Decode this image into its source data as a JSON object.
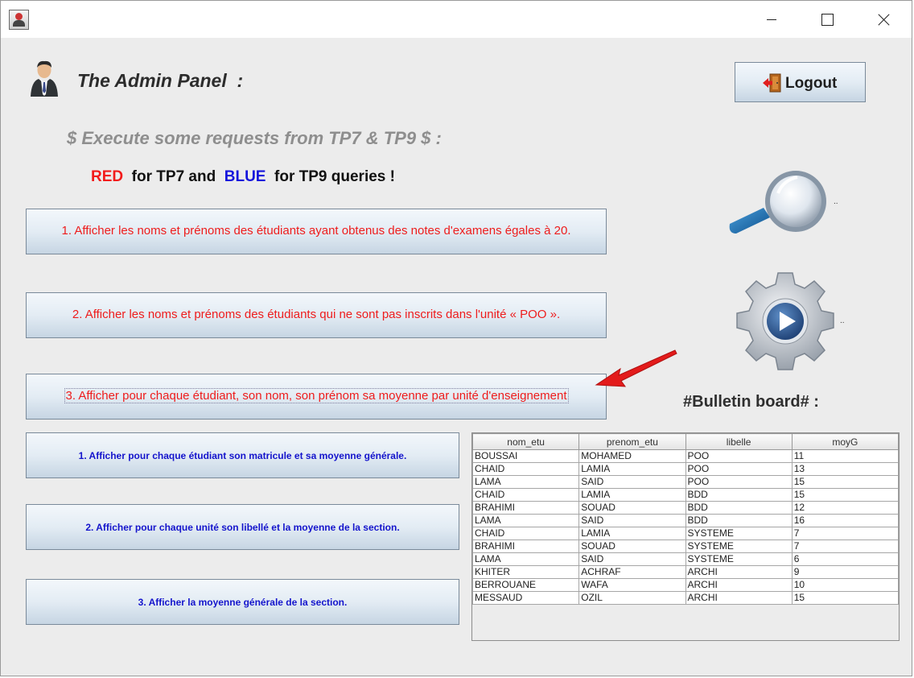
{
  "header": {
    "title": "The Admin Panel  :",
    "logout_label": "Logout"
  },
  "requests": {
    "subtitle": "$  Execute some requests from TP7 & TP9 $ :",
    "legend": {
      "red": "RED",
      "for_tp7": "  for TP7 and  ",
      "blue": "BLUE",
      "for_tp9": "  for TP9 queries !"
    },
    "tp7_buttons": [
      "1. Afficher les noms et prénoms des étudiants ayant obtenus des notes d'examens égales à 20.",
      "2. Afficher les noms et prénoms des étudiants qui ne sont pas inscrits dans l'unité « POO ».",
      "3. Afficher pour chaque étudiant, son nom, son prénom sa moyenne par unité d'enseignement"
    ],
    "tp9_buttons": [
      "1. Afficher pour chaque étudiant son matricule et sa moyenne générale.",
      "2. Afficher pour chaque unité son libellé et la moyenne de la section.",
      "3. Afficher la moyenne générale de la section."
    ]
  },
  "icons": {
    "search_dots": "..",
    "run_dots": ".."
  },
  "bulletin": {
    "title": "#Bulletin board# :",
    "columns": [
      "nom_etu",
      "prenom_etu",
      "libelle",
      "moyG"
    ],
    "rows": [
      [
        "BOUSSAI",
        "MOHAMED",
        "POO",
        "11"
      ],
      [
        "CHAID",
        "LAMIA",
        "POO",
        "13"
      ],
      [
        "LAMA",
        "SAID",
        "POO",
        "15"
      ],
      [
        "CHAID",
        "LAMIA",
        "BDD",
        "15"
      ],
      [
        "BRAHIMI",
        "SOUAD",
        "BDD",
        "12"
      ],
      [
        "LAMA",
        "SAID",
        "BDD",
        "16"
      ],
      [
        "CHAID",
        "LAMIA",
        "SYSTEME",
        "7"
      ],
      [
        "BRAHIMI",
        "SOUAD",
        "SYSTEME",
        "7"
      ],
      [
        "LAMA",
        "SAID",
        "SYSTEME",
        "6"
      ],
      [
        "KHITER",
        "ACHRAF",
        "ARCHI",
        "9"
      ],
      [
        "BERROUANE",
        "WAFA",
        "ARCHI",
        "10"
      ],
      [
        "MESSAUD",
        "OZIL",
        "ARCHI",
        "15"
      ]
    ]
  },
  "colors": {
    "tp7": "#f21b1b",
    "tp9": "#1414dc"
  }
}
